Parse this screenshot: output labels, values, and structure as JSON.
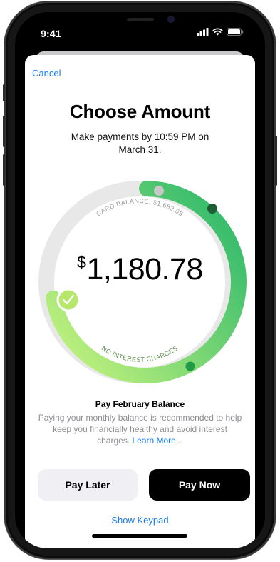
{
  "status_bar": {
    "time": "9:41"
  },
  "navigation": {
    "cancel_label": "Cancel"
  },
  "header": {
    "title": "Choose Amount",
    "subtitle": "Make payments by 10:59 PM on March 31."
  },
  "dial": {
    "currency_symbol": "$",
    "amount": "1,180.78",
    "card_balance_label": "CARD BALANCE: $1,682.55",
    "no_interest_label": "NO INTEREST CHARGES",
    "colors": {
      "track": "#e8e8e8",
      "green_light": "#b8ee7c",
      "green_dark": "#2db86b",
      "handle": "#b6e66a"
    }
  },
  "payment_info": {
    "title": "Pay February Balance",
    "description": "Paying your monthly balance is recommended to help keep you financially healthy and avoid interest charges. ",
    "learn_more": "Learn More..."
  },
  "actions": {
    "pay_later_label": "Pay Later",
    "pay_now_label": "Pay Now",
    "show_keypad_label": "Show Keypad"
  }
}
